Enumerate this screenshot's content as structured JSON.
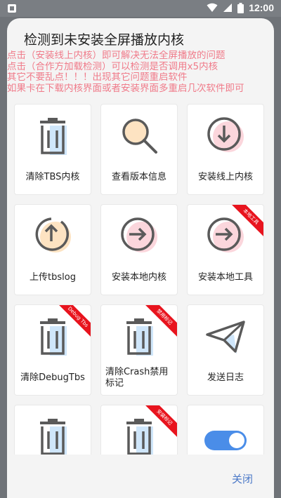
{
  "status_bar": {
    "time": "12:00"
  },
  "dialog": {
    "title": "检测到未安装全屏播放内核",
    "notice_lines": [
      "点击（安装线上内核）即可解决无法全屏播放的问题",
      "点击（合作方加载检测）可以检测是否调用x5内核",
      "其它不要乱点！！！出现其它问题重启软件",
      "如果卡在下载内核界面或者安装界面多重启几次软件即可"
    ],
    "cards": [
      {
        "label": "清除TBS内核",
        "icon": "trash-icon"
      },
      {
        "label": "查看版本信息",
        "icon": "magnifier-icon"
      },
      {
        "label": "安装线上内核",
        "icon": "download-arrow-icon"
      },
      {
        "label": "上传tbslog",
        "icon": "upload-arrow-icon"
      },
      {
        "label": "安装本地内核",
        "icon": "right-arrow-circle-icon"
      },
      {
        "label": "安装本地工具",
        "icon": "right-arrow-circle-icon",
        "ribbon": "本地工具"
      },
      {
        "label": "清除DebugTbs",
        "icon": "trash-icon",
        "ribbon": "Debug Tbs"
      },
      {
        "label": "清除Crash禁用标记",
        "icon": "trash-icon",
        "ribbon": "禁用标记"
      },
      {
        "label": "发送日志",
        "icon": "paper-plane-icon"
      },
      {
        "label": "",
        "icon": "trash-icon"
      },
      {
        "label": "",
        "icon": "trash-icon",
        "ribbon": "安装标记"
      },
      {
        "label": "",
        "icon": "toggle-switch-icon"
      }
    ],
    "close_label": "关闭"
  },
  "colors": {
    "notice": "#f07b8a",
    "ribbon": "#e8141e",
    "close": "#4a78c7",
    "accent_blue": "#cfe6fa",
    "accent_orange": "#fde3c2",
    "accent_pink": "#fbd6dc"
  }
}
